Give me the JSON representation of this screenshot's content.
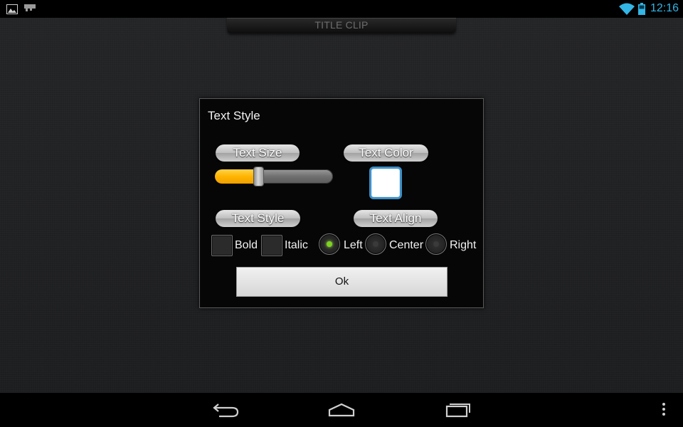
{
  "status_bar": {
    "time": "12:16",
    "icons": [
      "gallery-icon",
      "notification-icon",
      "wifi-icon",
      "battery-icon"
    ],
    "accent": "#33b5e5"
  },
  "app": {
    "title_tab": "TITLE CLIP"
  },
  "dialog": {
    "title": "Text Style",
    "text_size": {
      "label": "Text Size",
      "slider_fraction": 0.35
    },
    "text_color": {
      "label": "Text Color",
      "color": "#ffffff"
    },
    "text_style": {
      "label": "Text Style",
      "options": [
        {
          "label": "Bold",
          "checked": false
        },
        {
          "label": "Italic",
          "checked": false
        }
      ]
    },
    "text_align": {
      "label": "Text Align",
      "options": [
        {
          "label": "Left",
          "selected": true
        },
        {
          "label": "Center",
          "selected": false
        },
        {
          "label": "Right",
          "selected": false
        }
      ]
    },
    "ok_label": "Ok"
  },
  "nav_bar": {
    "buttons": [
      "back-icon",
      "home-icon",
      "recents-icon",
      "overflow-menu-icon"
    ]
  },
  "colors": {
    "slider_fill": "#ffb400",
    "radio_selected": "#7ed321",
    "swatch_border": "#3e8fc6"
  }
}
